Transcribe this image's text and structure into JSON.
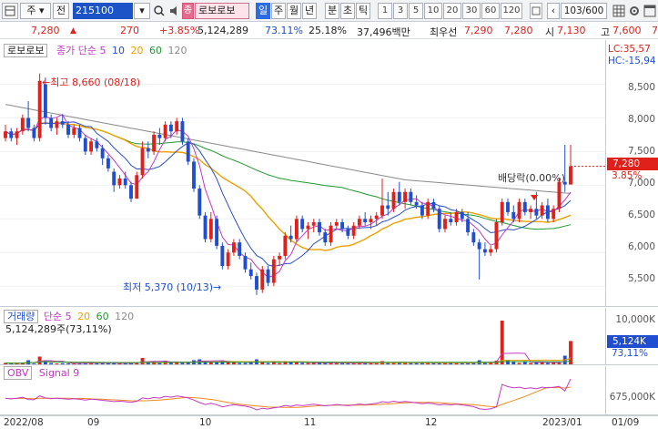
{
  "toolbar": {
    "market_tab": "주",
    "unit_tab": "전",
    "code": "215100",
    "name_badge": "종",
    "stock_name": "로보로보",
    "period_tabs": [
      "일",
      "주",
      "월",
      "년",
      "분",
      "초",
      "틱"
    ],
    "interval_tabs": [
      "1",
      "3",
      "5",
      "10",
      "20",
      "30",
      "60",
      "120"
    ],
    "count": "103/600"
  },
  "quote": {
    "price": "7,280",
    "change": "270",
    "change_pct": "+3.85%",
    "volume": "5,124,289",
    "vol_ratio": "73.11%",
    "turnover": "25.18%",
    "amount": "37,496백만",
    "best_label": "최우선",
    "ask": "7,290",
    "bid": "7,280",
    "open_label": "시",
    "open": "7,130",
    "high_label": "고",
    "high": "7,600",
    "low_label": "저",
    "low": "7,"
  },
  "price_pane": {
    "name_box": "로보로보",
    "ma_title": "종가 단순",
    "ma_periods": [
      "5",
      "10",
      "20",
      "60",
      "120"
    ],
    "lc": "LC:35,57",
    "hc": "HC:-15,94",
    "high_note": "최고 8,660 (08/18)",
    "low_note": "최저 5,370 (10/13)",
    "dividend_note": "배당락(0.00%)",
    "current_tag": "7,280",
    "current_pct": "3.85%",
    "y_ticks": [
      "8,500",
      "8,000",
      "7,500",
      "7,000",
      "6,500",
      "6,000",
      "5,500"
    ]
  },
  "volume_pane": {
    "title": "거래량",
    "ma_title": "단순",
    "ma_periods": [
      "5",
      "20",
      "60",
      "120"
    ],
    "value_line": "5,124,289주(73,11%)",
    "y_tick": "10,000K",
    "current_tag": "5,124K",
    "current_pct": "73,11%"
  },
  "obv_pane": {
    "title": "OBV",
    "signal": "Signal 9",
    "y_tick": "675,000K"
  },
  "x_axis": [
    "2022/08",
    "09",
    "10",
    "11",
    "12",
    "2023/01",
    "01/09"
  ],
  "colors": {
    "up": "#e0201b",
    "down": "#1f4fd0",
    "ma5": "#c438c4",
    "ma10": "#2a4ec8",
    "ma20": "#f0a000",
    "ma60": "#1f9a2f",
    "ma120": "#8a8a8a"
  },
  "chart_data": {
    "type": "candlestick",
    "y_range": [
      5300,
      8750
    ],
    "candles": [
      [
        7700,
        7900,
        7650,
        7800
      ],
      [
        7800,
        7850,
        7650,
        7700
      ],
      [
        7700,
        7850,
        7600,
        7800
      ],
      [
        7800,
        8050,
        7750,
        8000
      ],
      [
        8000,
        8250,
        7800,
        7850
      ],
      [
        7850,
        7900,
        7650,
        7700
      ],
      [
        7700,
        8660,
        7650,
        8550
      ],
      [
        8500,
        8600,
        7900,
        8000
      ],
      [
        8000,
        8050,
        7800,
        7850
      ],
      [
        7850,
        8000,
        7750,
        7950
      ],
      [
        7950,
        8050,
        7850,
        7900
      ],
      [
        7900,
        7950,
        7700,
        7750
      ],
      [
        7750,
        7900,
        7700,
        7850
      ],
      [
        7850,
        7900,
        7650,
        7700
      ],
      [
        7700,
        7750,
        7450,
        7500
      ],
      [
        7500,
        7700,
        7450,
        7650
      ],
      [
        7650,
        7700,
        7500,
        7550
      ],
      [
        7550,
        7600,
        7300,
        7400
      ],
      [
        7400,
        7450,
        7200,
        7250
      ],
      [
        7200,
        7250,
        6900,
        7000
      ],
      [
        7000,
        7150,
        6950,
        7100
      ],
      [
        7100,
        7200,
        6950,
        7000
      ],
      [
        7000,
        7050,
        6750,
        6800
      ],
      [
        6800,
        7200,
        6800,
        7150
      ],
      [
        7150,
        7650,
        7100,
        7550
      ],
      [
        7550,
        7650,
        7400,
        7500
      ],
      [
        7500,
        7800,
        7450,
        7750
      ],
      [
        7750,
        7850,
        7600,
        7700
      ],
      [
        7700,
        7950,
        7650,
        7900
      ],
      [
        7900,
        7950,
        7700,
        7800
      ],
      [
        7800,
        8000,
        7750,
        7950
      ],
      [
        7950,
        8000,
        7600,
        7650
      ],
      [
        7650,
        7700,
        7300,
        7350
      ],
      [
        7350,
        7400,
        6900,
        6950
      ],
      [
        6950,
        7000,
        6500,
        6550
      ],
      [
        6550,
        6600,
        6150,
        6200
      ],
      [
        6200,
        6600,
        6150,
        6500
      ],
      [
        6500,
        6550,
        6050,
        6100
      ],
      [
        6100,
        6150,
        5750,
        5800
      ],
      [
        5800,
        6050,
        5750,
        6000
      ],
      [
        6000,
        6200,
        5950,
        6150
      ],
      [
        6150,
        6200,
        5900,
        5950
      ],
      [
        5950,
        6000,
        5700,
        5750
      ],
      [
        5750,
        5850,
        5600,
        5650
      ],
      [
        5650,
        5700,
        5370,
        5450
      ],
      [
        5450,
        5800,
        5400,
        5750
      ],
      [
        5750,
        5800,
        5500,
        5550
      ],
      [
        5550,
        5950,
        5500,
        5900
      ],
      [
        5900,
        6000,
        5800,
        5950
      ],
      [
        5950,
        6300,
        5900,
        6250
      ],
      [
        6250,
        6400,
        6150,
        6200
      ],
      [
        6200,
        6550,
        6150,
        6500
      ],
      [
        6500,
        6550,
        6300,
        6350
      ],
      [
        6350,
        6450,
        6200,
        6400
      ],
      [
        6400,
        6500,
        6300,
        6450
      ],
      [
        6450,
        6500,
        6250,
        6300
      ],
      [
        6300,
        6350,
        6100,
        6150
      ],
      [
        6150,
        6450,
        6100,
        6400
      ],
      [
        6400,
        6500,
        6350,
        6450
      ],
      [
        6450,
        6500,
        6300,
        6350
      ],
      [
        6350,
        6400,
        6200,
        6250
      ],
      [
        6250,
        6450,
        6200,
        6400
      ],
      [
        6400,
        6550,
        6350,
        6500
      ],
      [
        6500,
        6600,
        6400,
        6450
      ],
      [
        6450,
        6550,
        6350,
        6500
      ],
      [
        6500,
        6600,
        6400,
        6550
      ],
      [
        6550,
        7100,
        6500,
        6700
      ],
      [
        6700,
        6900,
        6550,
        6650
      ],
      [
        6650,
        6950,
        6600,
        6900
      ],
      [
        6900,
        7050,
        6700,
        6750
      ],
      [
        6750,
        6950,
        6650,
        6900
      ],
      [
        6900,
        6950,
        6700,
        6750
      ],
      [
        6750,
        6850,
        6650,
        6700
      ],
      [
        6700,
        6750,
        6500,
        6550
      ],
      [
        6550,
        6800,
        6500,
        6750
      ],
      [
        6750,
        6800,
        6600,
        6650
      ],
      [
        6650,
        6700,
        6300,
        6350
      ],
      [
        6350,
        6550,
        6300,
        6500
      ],
      [
        6500,
        6600,
        6400,
        6450
      ],
      [
        6450,
        6650,
        6400,
        6600
      ],
      [
        6600,
        6650,
        6450,
        6500
      ],
      [
        6500,
        6600,
        6250,
        6300
      ],
      [
        6300,
        6350,
        6100,
        6150
      ],
      [
        6150,
        6200,
        5600,
        6050
      ],
      [
        6050,
        6150,
        5950,
        6000
      ],
      [
        6000,
        6100,
        5950,
        6050
      ],
      [
        6050,
        6500,
        6000,
        6450
      ],
      [
        6450,
        6800,
        6400,
        6750
      ],
      [
        6750,
        6800,
        6550,
        6600
      ],
      [
        6600,
        6700,
        6450,
        6500
      ],
      [
        6500,
        6800,
        6450,
        6750
      ],
      [
        6750,
        6800,
        6550,
        6600
      ],
      [
        6600,
        6700,
        6500,
        6650
      ],
      [
        6650,
        6900,
        6500,
        6550
      ],
      [
        6550,
        6750,
        6500,
        6700
      ],
      [
        6700,
        6800,
        6450,
        6500
      ],
      [
        6500,
        6700,
        6450,
        6650
      ],
      [
        6650,
        7100,
        6600,
        7050
      ],
      [
        7050,
        7600,
        6900,
        7010
      ],
      [
        7010,
        7600,
        7100,
        7280
      ]
    ],
    "volume_k": [
      300,
      200,
      250,
      400,
      900,
      150,
      1700,
      900,
      300,
      200,
      250,
      200,
      200,
      250,
      300,
      400,
      200,
      300,
      250,
      300,
      200,
      250,
      300,
      500,
      1400,
      400,
      600,
      300,
      800,
      400,
      500,
      300,
      500,
      900,
      1100,
      800,
      500,
      600,
      900,
      500,
      400,
      300,
      300,
      500,
      1100,
      700,
      300,
      500,
      300,
      700,
      400,
      600,
      300,
      300,
      300,
      300,
      400,
      300,
      300,
      300,
      200,
      300,
      400,
      300,
      300,
      300,
      700,
      300,
      500,
      400,
      300,
      300,
      300,
      400,
      300,
      300,
      500,
      300,
      300,
      300,
      300,
      300,
      400,
      900,
      300,
      300,
      800,
      9600,
      1000,
      500,
      300,
      600,
      300,
      400,
      700,
      300,
      300,
      300,
      1900,
      5124
    ],
    "obv_note": "OBV rises modestly through period with a jump near the end"
  }
}
